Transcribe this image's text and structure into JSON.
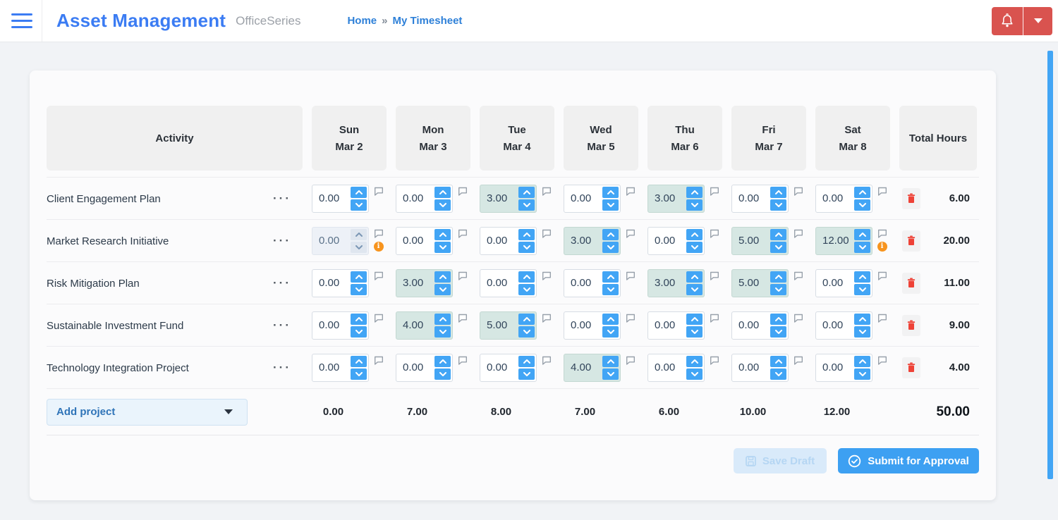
{
  "header": {
    "app_title": "Asset Management",
    "app_subtitle": "OfficeSeries",
    "breadcrumb": {
      "home": "Home",
      "separator": "»",
      "current": "My Timesheet"
    }
  },
  "colors": {
    "page_bg": "#f1f3f6",
    "card_bg": "#fbfbfc",
    "accent": "#42a5f5",
    "title_blue": "#3b7cf3",
    "link_blue": "#2e80d8",
    "danger_red": "#d9534f",
    "delete_red": "#ee4237",
    "warning_orange": "#f7941e",
    "filled_bg": "#d6e7e3",
    "filled_border": "#c3d8d2",
    "disabled_bg": "#edf1f7",
    "chip_bg": "#f0f0f0",
    "save_bg": "#d9eafa",
    "save_fg": "#b5d6f3",
    "submit_bg": "#3da0f2"
  },
  "icons": {
    "menu": "hamburger",
    "notifications": "bell",
    "account": "caret-down",
    "row_menu_glyph": "···",
    "comment": "speech-bubble",
    "warning_glyph": "i",
    "delete": "trash",
    "save": "floppy-disk",
    "submit": "check-circle",
    "add_project_caret": "caret-down"
  },
  "timesheet": {
    "activity_header": "Activity",
    "total_header": "Total Hours",
    "columns": [
      {
        "day": "Sun",
        "date": "Mar 2"
      },
      {
        "day": "Mon",
        "date": "Mar 3"
      },
      {
        "day": "Tue",
        "date": "Mar 4"
      },
      {
        "day": "Wed",
        "date": "Mar 5"
      },
      {
        "day": "Thu",
        "date": "Mar 6"
      },
      {
        "day": "Fri",
        "date": "Mar 7"
      },
      {
        "day": "Sat",
        "date": "Mar 8"
      }
    ],
    "rows": [
      {
        "activity": "Client Engagement Plan",
        "total": "6.00",
        "cells": [
          {
            "value": "0.00"
          },
          {
            "value": "0.00"
          },
          {
            "value": "3.00",
            "filled": true
          },
          {
            "value": "0.00"
          },
          {
            "value": "3.00",
            "filled": true
          },
          {
            "value": "0.00"
          },
          {
            "value": "0.00"
          }
        ]
      },
      {
        "activity": "Market Research Initiative",
        "total": "20.00",
        "cells": [
          {
            "value": "0.00",
            "disabled": true,
            "warning": true
          },
          {
            "value": "0.00"
          },
          {
            "value": "0.00"
          },
          {
            "value": "3.00",
            "filled": true
          },
          {
            "value": "0.00"
          },
          {
            "value": "5.00",
            "filled": true
          },
          {
            "value": "12.00",
            "filled": true,
            "warning": true
          }
        ]
      },
      {
        "activity": "Risk Mitigation Plan",
        "total": "11.00",
        "cells": [
          {
            "value": "0.00"
          },
          {
            "value": "3.00",
            "filled": true
          },
          {
            "value": "0.00"
          },
          {
            "value": "0.00"
          },
          {
            "value": "3.00",
            "filled": true
          },
          {
            "value": "5.00",
            "filled": true
          },
          {
            "value": "0.00"
          }
        ]
      },
      {
        "activity": "Sustainable Investment Fund",
        "total": "9.00",
        "cells": [
          {
            "value": "0.00"
          },
          {
            "value": "4.00",
            "filled": true
          },
          {
            "value": "5.00",
            "filled": true
          },
          {
            "value": "0.00"
          },
          {
            "value": "0.00"
          },
          {
            "value": "0.00"
          },
          {
            "value": "0.00"
          }
        ]
      },
      {
        "activity": "Technology Integration Project",
        "total": "4.00",
        "cells": [
          {
            "value": "0.00"
          },
          {
            "value": "0.00"
          },
          {
            "value": "0.00"
          },
          {
            "value": "4.00",
            "filled": true
          },
          {
            "value": "0.00"
          },
          {
            "value": "0.00"
          },
          {
            "value": "0.00"
          }
        ]
      }
    ],
    "footer": {
      "add_project_label": "Add project",
      "day_totals": [
        "0.00",
        "7.00",
        "8.00",
        "7.00",
        "6.00",
        "10.00",
        "12.00"
      ],
      "grand_total": "50.00"
    },
    "buttons": {
      "save_draft": "Save Draft",
      "submit": "Submit for Approval"
    }
  }
}
